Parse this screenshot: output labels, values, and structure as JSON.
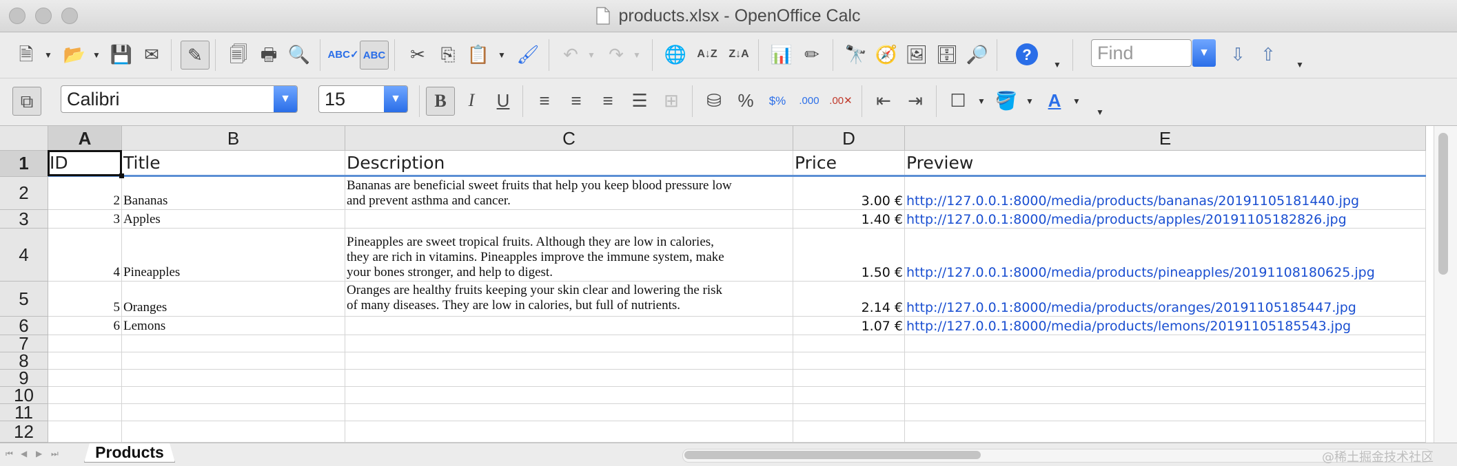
{
  "window": {
    "title": "products.xlsx - OpenOffice Calc"
  },
  "toolbar2": {
    "font_name": "Calibri",
    "font_size": "15"
  },
  "find": {
    "placeholder": "Find"
  },
  "columns": [
    "A",
    "B",
    "C",
    "D",
    "E"
  ],
  "rows": [
    "1",
    "2",
    "3",
    "4",
    "5",
    "6",
    "7",
    "8",
    "9",
    "10",
    "11",
    "12"
  ],
  "header_row": {
    "id": "ID",
    "title": "Title",
    "description": "Description",
    "price": "Price",
    "preview": "Preview"
  },
  "products": [
    {
      "id": "2",
      "title": "Bananas",
      "description": [
        "Bananas are beneficial sweet fruits that help you keep blood pressure low",
        "and prevent asthma and cancer."
      ],
      "price": "3.00 €",
      "preview": "http://127.0.0.1:8000/media/products/bananas/20191105181440.jpg"
    },
    {
      "id": "3",
      "title": "Apples",
      "description": [],
      "price": "1.40 €",
      "preview": "http://127.0.0.1:8000/media/products/apples/20191105182826.jpg"
    },
    {
      "id": "4",
      "title": "Pineapples",
      "description": [
        "Pineapples are sweet tropical fruits. Although they are low in calories,",
        "they are rich in vitamins. Pineapples improve the immune system, make",
        "your bones stronger, and help to digest."
      ],
      "price": "1.50 €",
      "preview": "http://127.0.0.1:8000/media/products/pineapples/20191108180625.jpg"
    },
    {
      "id": "5",
      "title": "Oranges",
      "description": [
        "Oranges are healthy fruits keeping your skin clear and lowering the risk",
        "of many diseases. They are low in calories, but full of nutrients."
      ],
      "price": "2.14 €",
      "preview": "http://127.0.0.1:8000/media/products/oranges/20191105185447.jpg"
    },
    {
      "id": "6",
      "title": "Lemons",
      "description": [],
      "price": "1.07 €",
      "preview": "http://127.0.0.1:8000/media/products/lemons/20191105185543.jpg"
    }
  ],
  "sheet_tabs": [
    "Products"
  ],
  "watermark": "@稀土掘金技术社区"
}
